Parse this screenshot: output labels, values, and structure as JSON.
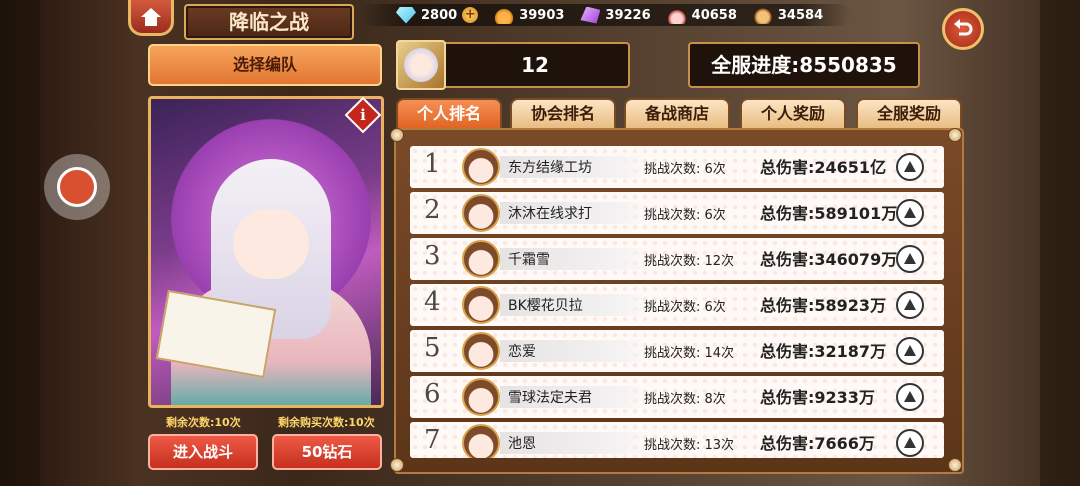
{
  "title": "降临之战",
  "resources": [
    {
      "icon": "diamond-icon",
      "value": "2800",
      "has_plus": true
    },
    {
      "icon": "potion-icon",
      "value": "39903"
    },
    {
      "icon": "crystal-icon",
      "value": "39226"
    },
    {
      "icon": "cake-icon",
      "value": "40658"
    },
    {
      "icon": "bun-icon",
      "value": "34584"
    }
  ],
  "left_panel": {
    "team_button": "选择编队",
    "remaining_times": "剩余次数:10次",
    "remaining_buy": "剩余购买次数:10次",
    "enter_battle": "进入战斗",
    "diamond_button": "50钻石",
    "info_badge": "i"
  },
  "ticket_count": "12",
  "server_progress": "全服进度:8550835",
  "tabs": [
    "个人排名",
    "协会排名",
    "备战商店",
    "个人奖励",
    "全服奖励"
  ],
  "active_tab": 0,
  "ranking": [
    {
      "rank": "1",
      "name": "东方结缘工坊",
      "tries": "挑战次数: 6次",
      "damage": "总伤害:24651亿"
    },
    {
      "rank": "2",
      "name": "沐沐在线求打",
      "tries": "挑战次数: 6次",
      "damage": "总伤害:589101万"
    },
    {
      "rank": "3",
      "name": "千霜雪",
      "tries": "挑战次数: 12次",
      "damage": "总伤害:346079万"
    },
    {
      "rank": "4",
      "name": "BK樱花贝拉",
      "tries": "挑战次数: 6次",
      "damage": "总伤害:58923万"
    },
    {
      "rank": "5",
      "name": "恋爱",
      "tries": "挑战次数: 14次",
      "damage": "总伤害:32187万"
    },
    {
      "rank": "6",
      "name": "雪球法定夫君",
      "tries": "挑战次数: 8次",
      "damage": "总伤害:9233万"
    },
    {
      "rank": "7",
      "name": "池恩",
      "tries": "挑战次数: 13次",
      "damage": "总伤害:7666万"
    }
  ],
  "colors": {
    "accent": "#e17632",
    "frame": "#c9904a",
    "button_red": "#c5301f"
  }
}
